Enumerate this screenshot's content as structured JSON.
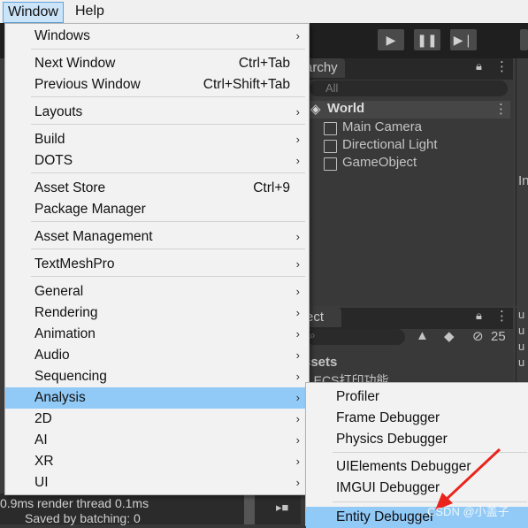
{
  "menubar": {
    "window": "Window",
    "help": "Help"
  },
  "hierarchy": {
    "tab": "archy",
    "search_placeholder": "All",
    "scene": "World",
    "items": [
      "Main Camera",
      "Directional Light",
      "GameObject"
    ]
  },
  "inspector": {
    "tab_fragment": "In"
  },
  "project": {
    "tab": "ect",
    "count": "25",
    "assets": "ssets",
    "folder": "1 ECS打印功能"
  },
  "console": {
    "extra": [
      "u",
      "u",
      "u",
      "u"
    ]
  },
  "stats": {
    "line1": "0.9ms   render thread 0.1ms",
    "line2": "Saved by batching: 0"
  },
  "menu": {
    "items": [
      {
        "label": "Windows",
        "shortcut": "",
        "submenu": true
      },
      {
        "label": "Next Window",
        "shortcut": "Ctrl+Tab",
        "submenu": false
      },
      {
        "label": "Previous Window",
        "shortcut": "Ctrl+Shift+Tab",
        "submenu": false
      },
      {
        "label": "Layouts",
        "shortcut": "",
        "submenu": true
      },
      {
        "label": "Build",
        "shortcut": "",
        "submenu": true
      },
      {
        "label": "DOTS",
        "shortcut": "",
        "submenu": true
      },
      {
        "label": "Asset Store",
        "shortcut": "Ctrl+9",
        "submenu": false
      },
      {
        "label": "Package Manager",
        "shortcut": "",
        "submenu": false
      },
      {
        "label": "Asset Management",
        "shortcut": "",
        "submenu": true
      },
      {
        "label": "TextMeshPro",
        "shortcut": "",
        "submenu": true
      },
      {
        "label": "General",
        "shortcut": "",
        "submenu": true
      },
      {
        "label": "Rendering",
        "shortcut": "",
        "submenu": true
      },
      {
        "label": "Animation",
        "shortcut": "",
        "submenu": true
      },
      {
        "label": "Audio",
        "shortcut": "",
        "submenu": true
      },
      {
        "label": "Sequencing",
        "shortcut": "",
        "submenu": true
      },
      {
        "label": "Analysis",
        "shortcut": "",
        "submenu": true
      },
      {
        "label": "2D",
        "shortcut": "",
        "submenu": true
      },
      {
        "label": "AI",
        "shortcut": "",
        "submenu": true
      },
      {
        "label": "XR",
        "shortcut": "",
        "submenu": true
      },
      {
        "label": "UI",
        "shortcut": "",
        "submenu": true
      }
    ],
    "arrow": "›"
  },
  "submenu": {
    "items": [
      "Profiler",
      "Frame Debugger",
      "Physics Debugger",
      "UIElements Debugger",
      "IMGUI Debugger",
      "Entity Debugger"
    ]
  },
  "watermark": "CSDN @小盖子",
  "colors": {
    "highlight": "#91c9f7",
    "annotation_arrow": "#e8241c"
  }
}
